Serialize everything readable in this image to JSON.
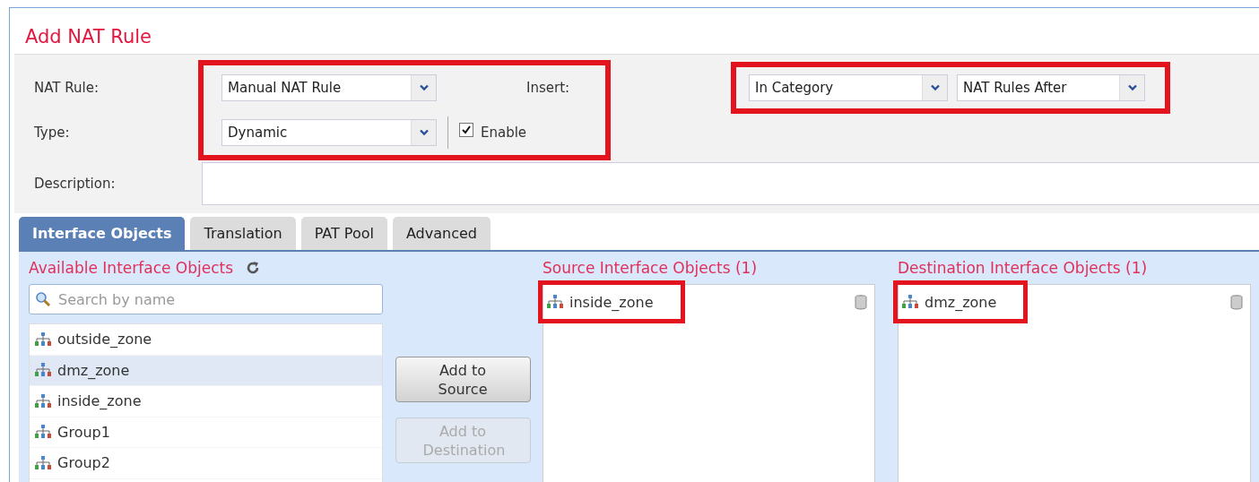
{
  "window": {
    "title": "Add NAT Rule"
  },
  "form": {
    "rule_group_highlighted": true,
    "insert_group_highlighted": true,
    "nat_rule": {
      "label": "NAT Rule:",
      "value": "Manual NAT Rule"
    },
    "type": {
      "label": "Type:",
      "value": "Dynamic"
    },
    "enable": {
      "label": "Enable",
      "checked": true
    },
    "insert": {
      "label": "Insert:",
      "category": "In Category",
      "position": "NAT Rules After"
    },
    "description": {
      "label": "Description:"
    }
  },
  "tabs": [
    {
      "label": "Interface Objects",
      "selected": true
    },
    {
      "label": "Translation",
      "selected": false
    },
    {
      "label": "PAT Pool",
      "selected": false
    },
    {
      "label": "Advanced",
      "selected": false
    }
  ],
  "available": {
    "title": "Available Interface Objects",
    "search": {
      "placeholder": "Search by name"
    },
    "items": [
      {
        "label": "outside_zone",
        "selected": false
      },
      {
        "label": "dmz_zone",
        "selected": true
      },
      {
        "label": "inside_zone",
        "selected": false
      },
      {
        "label": "Group1",
        "selected": false
      },
      {
        "label": "Group2",
        "selected": false
      }
    ]
  },
  "buttons": [
    {
      "label": "Add to Source",
      "disabled": false
    },
    {
      "label": "Add to Destination",
      "disabled": true
    }
  ],
  "source": {
    "title": "Source Interface Objects (1)",
    "items": [
      {
        "label": "inside_zone",
        "highlighted": true
      }
    ]
  },
  "destination": {
    "title": "Destination Interface Objects (1)",
    "items": [
      {
        "label": "dmz_zone",
        "highlighted": true
      }
    ]
  }
}
